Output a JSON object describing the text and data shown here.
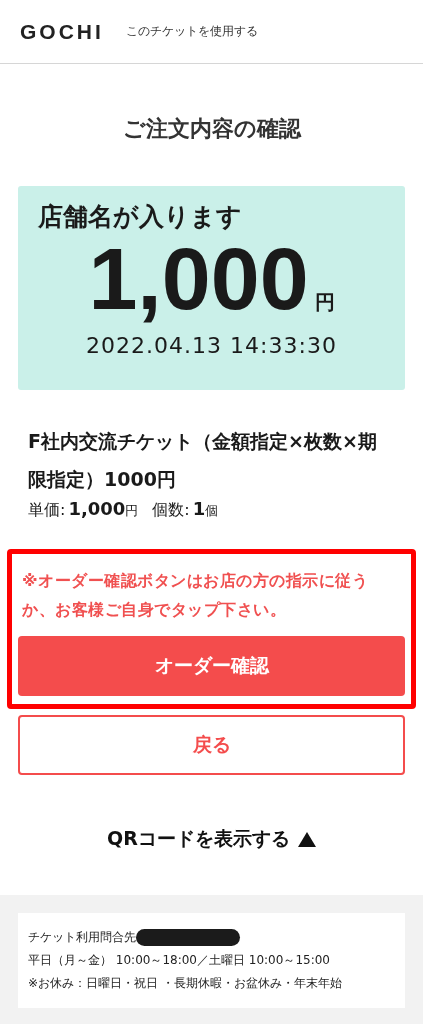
{
  "header": {
    "logo": "GOCHI",
    "subtitle": "このチケットを使用する"
  },
  "title": "ご注文内容の確認",
  "ticket": {
    "store": "店舗名が入ります",
    "amount": "1,000",
    "currency": "円",
    "datetime": "2022.04.13 14:33:30"
  },
  "product": {
    "name": "F社内交流チケット（金額指定×枚数×期限指定）1000円",
    "price_label": "単価:",
    "price": "1,000",
    "price_unit": "円",
    "qty_label": "個数:",
    "qty": "1",
    "qty_unit": "個"
  },
  "notice": "※オーダー確認ボタンはお店の方の指示に従うか、お客様ご自身でタップ下さい。",
  "buttons": [
    {
      "kind": "primary",
      "label": "オーダー確認"
    },
    {
      "kind": "secondary",
      "label": "戻る"
    }
  ],
  "qr_toggle": {
    "label": "QRコードを表示する",
    "expanded": false
  },
  "footer": {
    "lines": [
      {
        "text": "チケット利用問合先",
        "redacted": true
      },
      {
        "text": "平日（月～金） 10:00～18:00／土曜日 10:00～15:00",
        "redacted": false
      },
      {
        "text": "※お休み：日曜日・祝日 ・長期休暇・お盆休み・年末年始",
        "redacted": false
      }
    ]
  }
}
